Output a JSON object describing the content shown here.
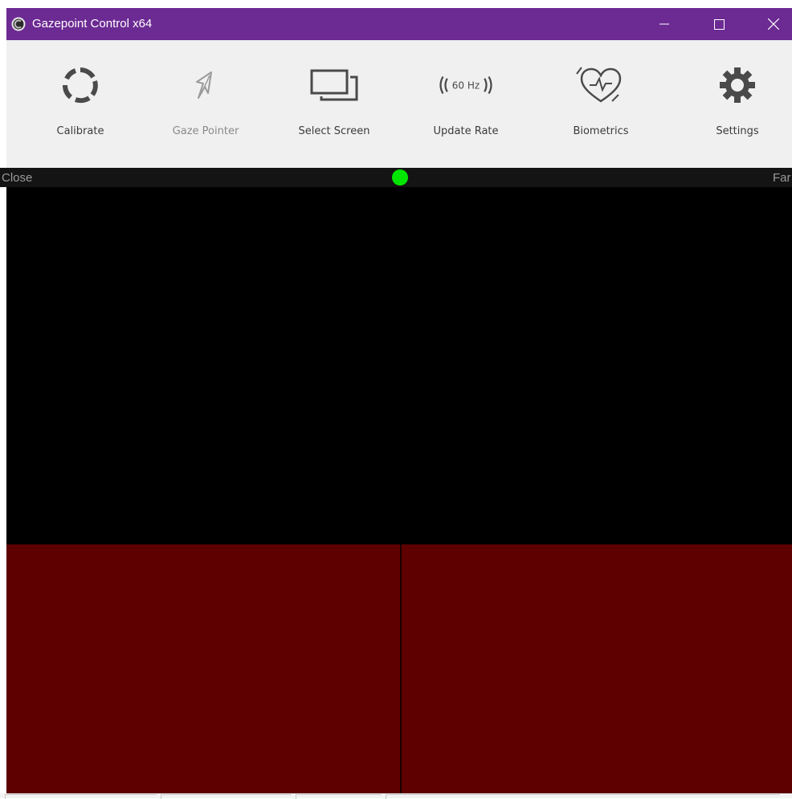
{
  "window": {
    "title": "Gazepoint Control x64",
    "accent_color": "#6c2a93",
    "controls": [
      {
        "name": "minimize-icon"
      },
      {
        "name": "maximize-icon"
      },
      {
        "name": "close-icon"
      }
    ]
  },
  "toolbar": {
    "items": [
      {
        "label": "Calibrate",
        "icon": "calibrate-aperture-icon",
        "enabled": true
      },
      {
        "label": "Gaze Pointer",
        "icon": "gaze-pointer-icon",
        "enabled": false
      },
      {
        "label": "Select Screen",
        "icon": "select-screen-icon",
        "enabled": true
      },
      {
        "label": "Update Rate",
        "icon": "update-rate-icon",
        "enabled": true,
        "icon_text": "60 Hz"
      },
      {
        "label": "Biometrics",
        "icon": "biometrics-heart-icon",
        "enabled": true
      },
      {
        "label": "Settings",
        "icon": "gear-icon",
        "enabled": true
      }
    ]
  },
  "distance": {
    "near_label": "Close",
    "far_label": "Far",
    "indicator_color": "#00e600"
  },
  "camera": {
    "background": "#000000"
  },
  "eyes": {
    "panel_color": "#5e0000"
  }
}
